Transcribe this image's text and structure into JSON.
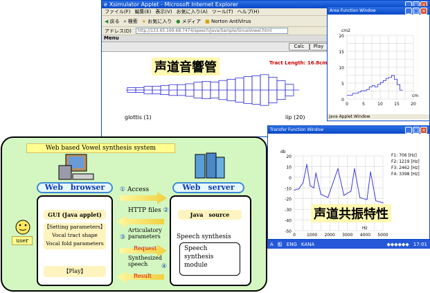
{
  "browser": {
    "title": "Xsimulator Applet - Microsoft Internet Explorer",
    "menu": [
      "ファイル(F)",
      "編集(E)",
      "表示(V)",
      "お気に入り(A)",
      "ツール(T)",
      "ヘルプ(H)"
    ],
    "toolbar": [
      "戻る",
      "検索",
      "お気に入り",
      "メディア",
      "Norton AntiVirus"
    ],
    "address_label": "アドレス(D)",
    "address_value": "http://133.65.169.68:7474/speech/Java/Sample/SinusVowel.html",
    "menu_label": "Menu",
    "calc_label": "Calc",
    "play_label": "Play"
  },
  "tract": {
    "title": "声道音響管",
    "length_label": "Tract Length: 16.8cm",
    "glottis": "glottis (1)",
    "lip": "lip (20)",
    "areas": [
      1.2,
      1.2,
      1.8,
      1.8,
      2.2,
      2.6,
      2.6,
      3.0,
      3.8,
      4.2,
      3.8,
      4.6,
      5.2,
      5.8,
      6.5,
      6.8,
      7.4,
      6.2,
      4.5,
      2.8
    ]
  },
  "area_window": {
    "title": "Area Function Window",
    "ylabel": "cm2",
    "xlabel": "cm",
    "yticks": [
      "20",
      "15",
      "10",
      "5",
      "0"
    ],
    "xticks": [
      "0",
      "5",
      "10",
      "15",
      "20"
    ],
    "footer": "Java Applet Window"
  },
  "transfer": {
    "title": "Transfer Function Window",
    "ylabel": "db",
    "xlabel": "Hz",
    "heading": "声道共振特性",
    "yticks": [
      "20",
      "10",
      "0",
      "-10",
      "-20",
      "-30",
      "-40",
      "-50"
    ],
    "xticks": [
      "0",
      "1000",
      "2000",
      "3000",
      "4000",
      "5000"
    ],
    "formants": [
      "F1: 706 [Hz]",
      "F2: 1219 [Hz]",
      "F3: 2462 [Hz]",
      "F4: 3398 [Hz]"
    ]
  },
  "chart_data": {
    "type": "line",
    "x": [
      0,
      250,
      500,
      706,
      900,
      1100,
      1219,
      1500,
      1900,
      2462,
      2800,
      3200,
      3398,
      3700,
      4100,
      4300,
      4600,
      5000
    ],
    "y": [
      -12,
      -11,
      -5,
      12,
      -8,
      -10,
      4,
      -16,
      -19,
      8,
      -17,
      -13,
      8,
      -19,
      -21,
      5,
      -22,
      -24
    ],
    "xlabel": "Hz",
    "ylabel": "db",
    "ylim": [
      -50,
      20
    ],
    "xlim": [
      0,
      5000
    ]
  },
  "taskbar": {
    "items": [
      "A",
      "般",
      "ENG",
      "KANA"
    ],
    "clock": "17:01"
  },
  "system": {
    "title": "Web based Vowel synthesis system",
    "web_browser": "Web　browser",
    "web_server": "Web　server",
    "gui": "GUI (Java applet)",
    "setting": "【Setting parameters】",
    "vocal_tract": "Vocal tract shape",
    "vocal_fold": "Vocal fold parameters",
    "play": "【Play】",
    "user": "user",
    "java_source": "Java　source",
    "speech_synthesis": "Speech synthesis",
    "module": [
      "Speech",
      "synthesis",
      "module"
    ],
    "arrows": [
      {
        "num": "①",
        "label": "Access"
      },
      {
        "num": "②",
        "label": "HTTP files"
      },
      {
        "num": "③",
        "label": "Articulatory parameters",
        "sub": "Request"
      },
      {
        "num": "④",
        "label": "Synthesized speech",
        "sub": "Result"
      }
    ]
  }
}
